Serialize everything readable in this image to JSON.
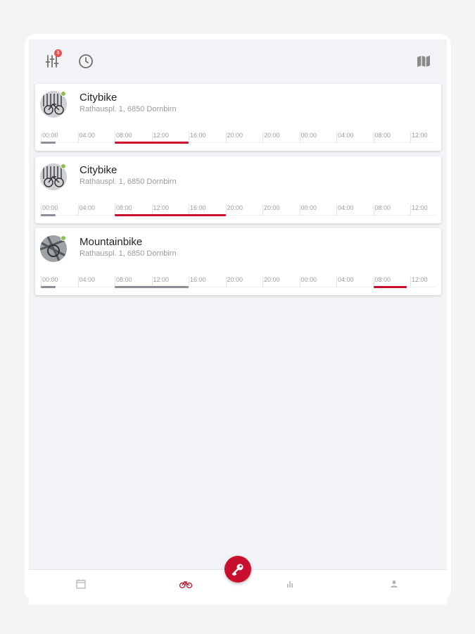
{
  "toolbar": {
    "filter_badge": "3",
    "icons": [
      "filter-icon",
      "clock-icon",
      "map-icon"
    ]
  },
  "colors": {
    "accent": "#c8102e",
    "booked_own": "#c8102e",
    "booked_other": "#8a8f98",
    "available_dot": "#8bc34a"
  },
  "bikes": [
    {
      "name": "Citybike",
      "address": "Rathauspl. 1, 6850 Dornbirn",
      "ticks": [
        "00:00",
        "04:00",
        "08:00",
        "12:00",
        "16:00",
        "20:00",
        "20:00",
        "00:00",
        "04:00",
        "08:00",
        "12:00"
      ],
      "bookings": [
        {
          "from": 0.0,
          "to": 0.4,
          "kind": "other"
        },
        {
          "from": 2.0,
          "to": 4.0,
          "kind": "own"
        }
      ]
    },
    {
      "name": "Citybike",
      "address": "Rathauspl. 1, 6850 Dornbirn",
      "ticks": [
        "00:00",
        "04:00",
        "08:00",
        "12:00",
        "16:00",
        "20:00",
        "20:00",
        "00:00",
        "04:00",
        "08:00",
        "12:00"
      ],
      "bookings": [
        {
          "from": 0.0,
          "to": 0.4,
          "kind": "other"
        },
        {
          "from": 2.0,
          "to": 5.0,
          "kind": "own"
        }
      ]
    },
    {
      "name": "Mountainbike",
      "address": "Rathauspl. 1, 6850 Dornbirn",
      "ticks": [
        "00:00",
        "04:00",
        "08:00",
        "12:00",
        "16:00",
        "20:00",
        "20:00",
        "00:00",
        "04:00",
        "08:00",
        "12:00"
      ],
      "bookings": [
        {
          "from": 0.0,
          "to": 0.4,
          "kind": "other"
        },
        {
          "from": 2.0,
          "to": 4.0,
          "kind": "other"
        },
        {
          "from": 9.0,
          "to": 9.9,
          "kind": "own"
        }
      ]
    }
  ],
  "bottom_nav": {
    "items": [
      "calendar-icon",
      "bike-icon",
      "stats-icon",
      "profile-icon"
    ],
    "active": "bike-icon",
    "fab": "key-icon"
  }
}
